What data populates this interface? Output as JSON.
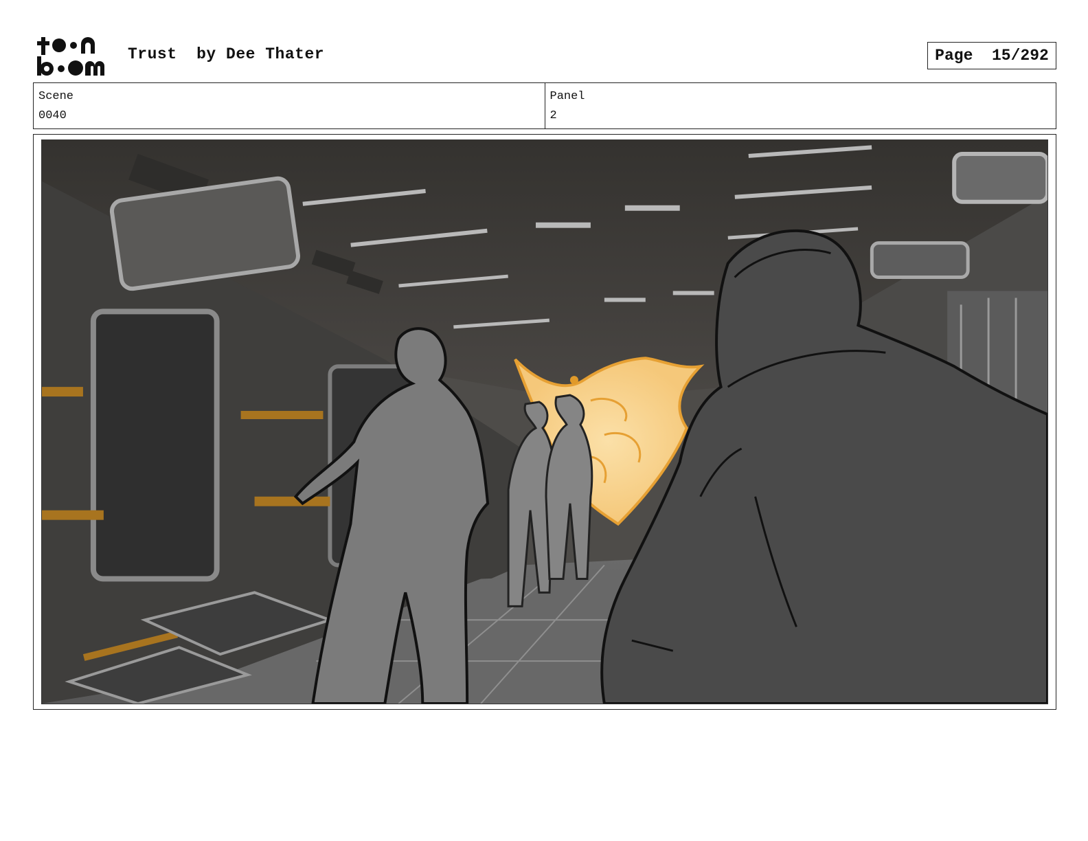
{
  "header": {
    "logo_alt": "toon boom",
    "title": "Trust  by Dee Thater",
    "page_label": "Page",
    "page_value": "15/292"
  },
  "info": {
    "scene_label": "Scene",
    "scene_value": "0040",
    "panel_label": "Panel",
    "panel_value": "2"
  },
  "panel": {
    "description": "storyboard-sketch",
    "colors": {
      "floor": "#5e5e5e",
      "ceiling": "#3c3a38",
      "accent": "#b07a22",
      "glow": "#f5c87a",
      "glow_line": "#e6a033",
      "figure_near": "#4a4a4a",
      "figure_mid": "#7b7b7b"
    }
  }
}
